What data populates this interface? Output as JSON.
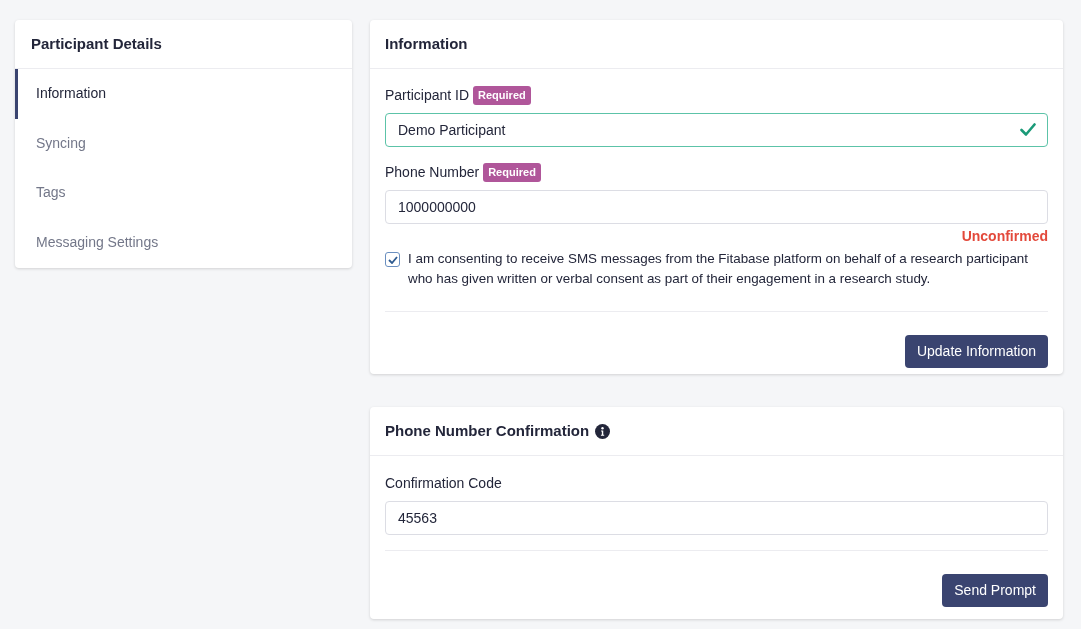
{
  "sidebar": {
    "title": "Participant Details",
    "items": [
      {
        "label": "Information",
        "selected": true
      },
      {
        "label": "Syncing",
        "selected": false
      },
      {
        "label": "Tags",
        "selected": false
      },
      {
        "label": "Messaging Settings",
        "selected": false
      }
    ]
  },
  "information": {
    "title": "Information",
    "fields": [
      {
        "label": "Participant ID",
        "badge": "Required",
        "value": "Demo Participant",
        "valid": true
      },
      {
        "label": "Phone Number",
        "badge": "Required",
        "value": "1000000000",
        "valid": false,
        "status": "Unconfirmed"
      }
    ],
    "consent": {
      "checked": true,
      "text": "I am consenting to receive SMS messages from the Fitabase platform on behalf of a research participant who has given written or verbal consent as part of their engagement in a research study."
    },
    "button": "Update Information"
  },
  "confirmation": {
    "title": "Phone Number Confirmation",
    "field": {
      "label": "Confirmation Code",
      "value": "45563"
    },
    "button": "Send Prompt"
  }
}
